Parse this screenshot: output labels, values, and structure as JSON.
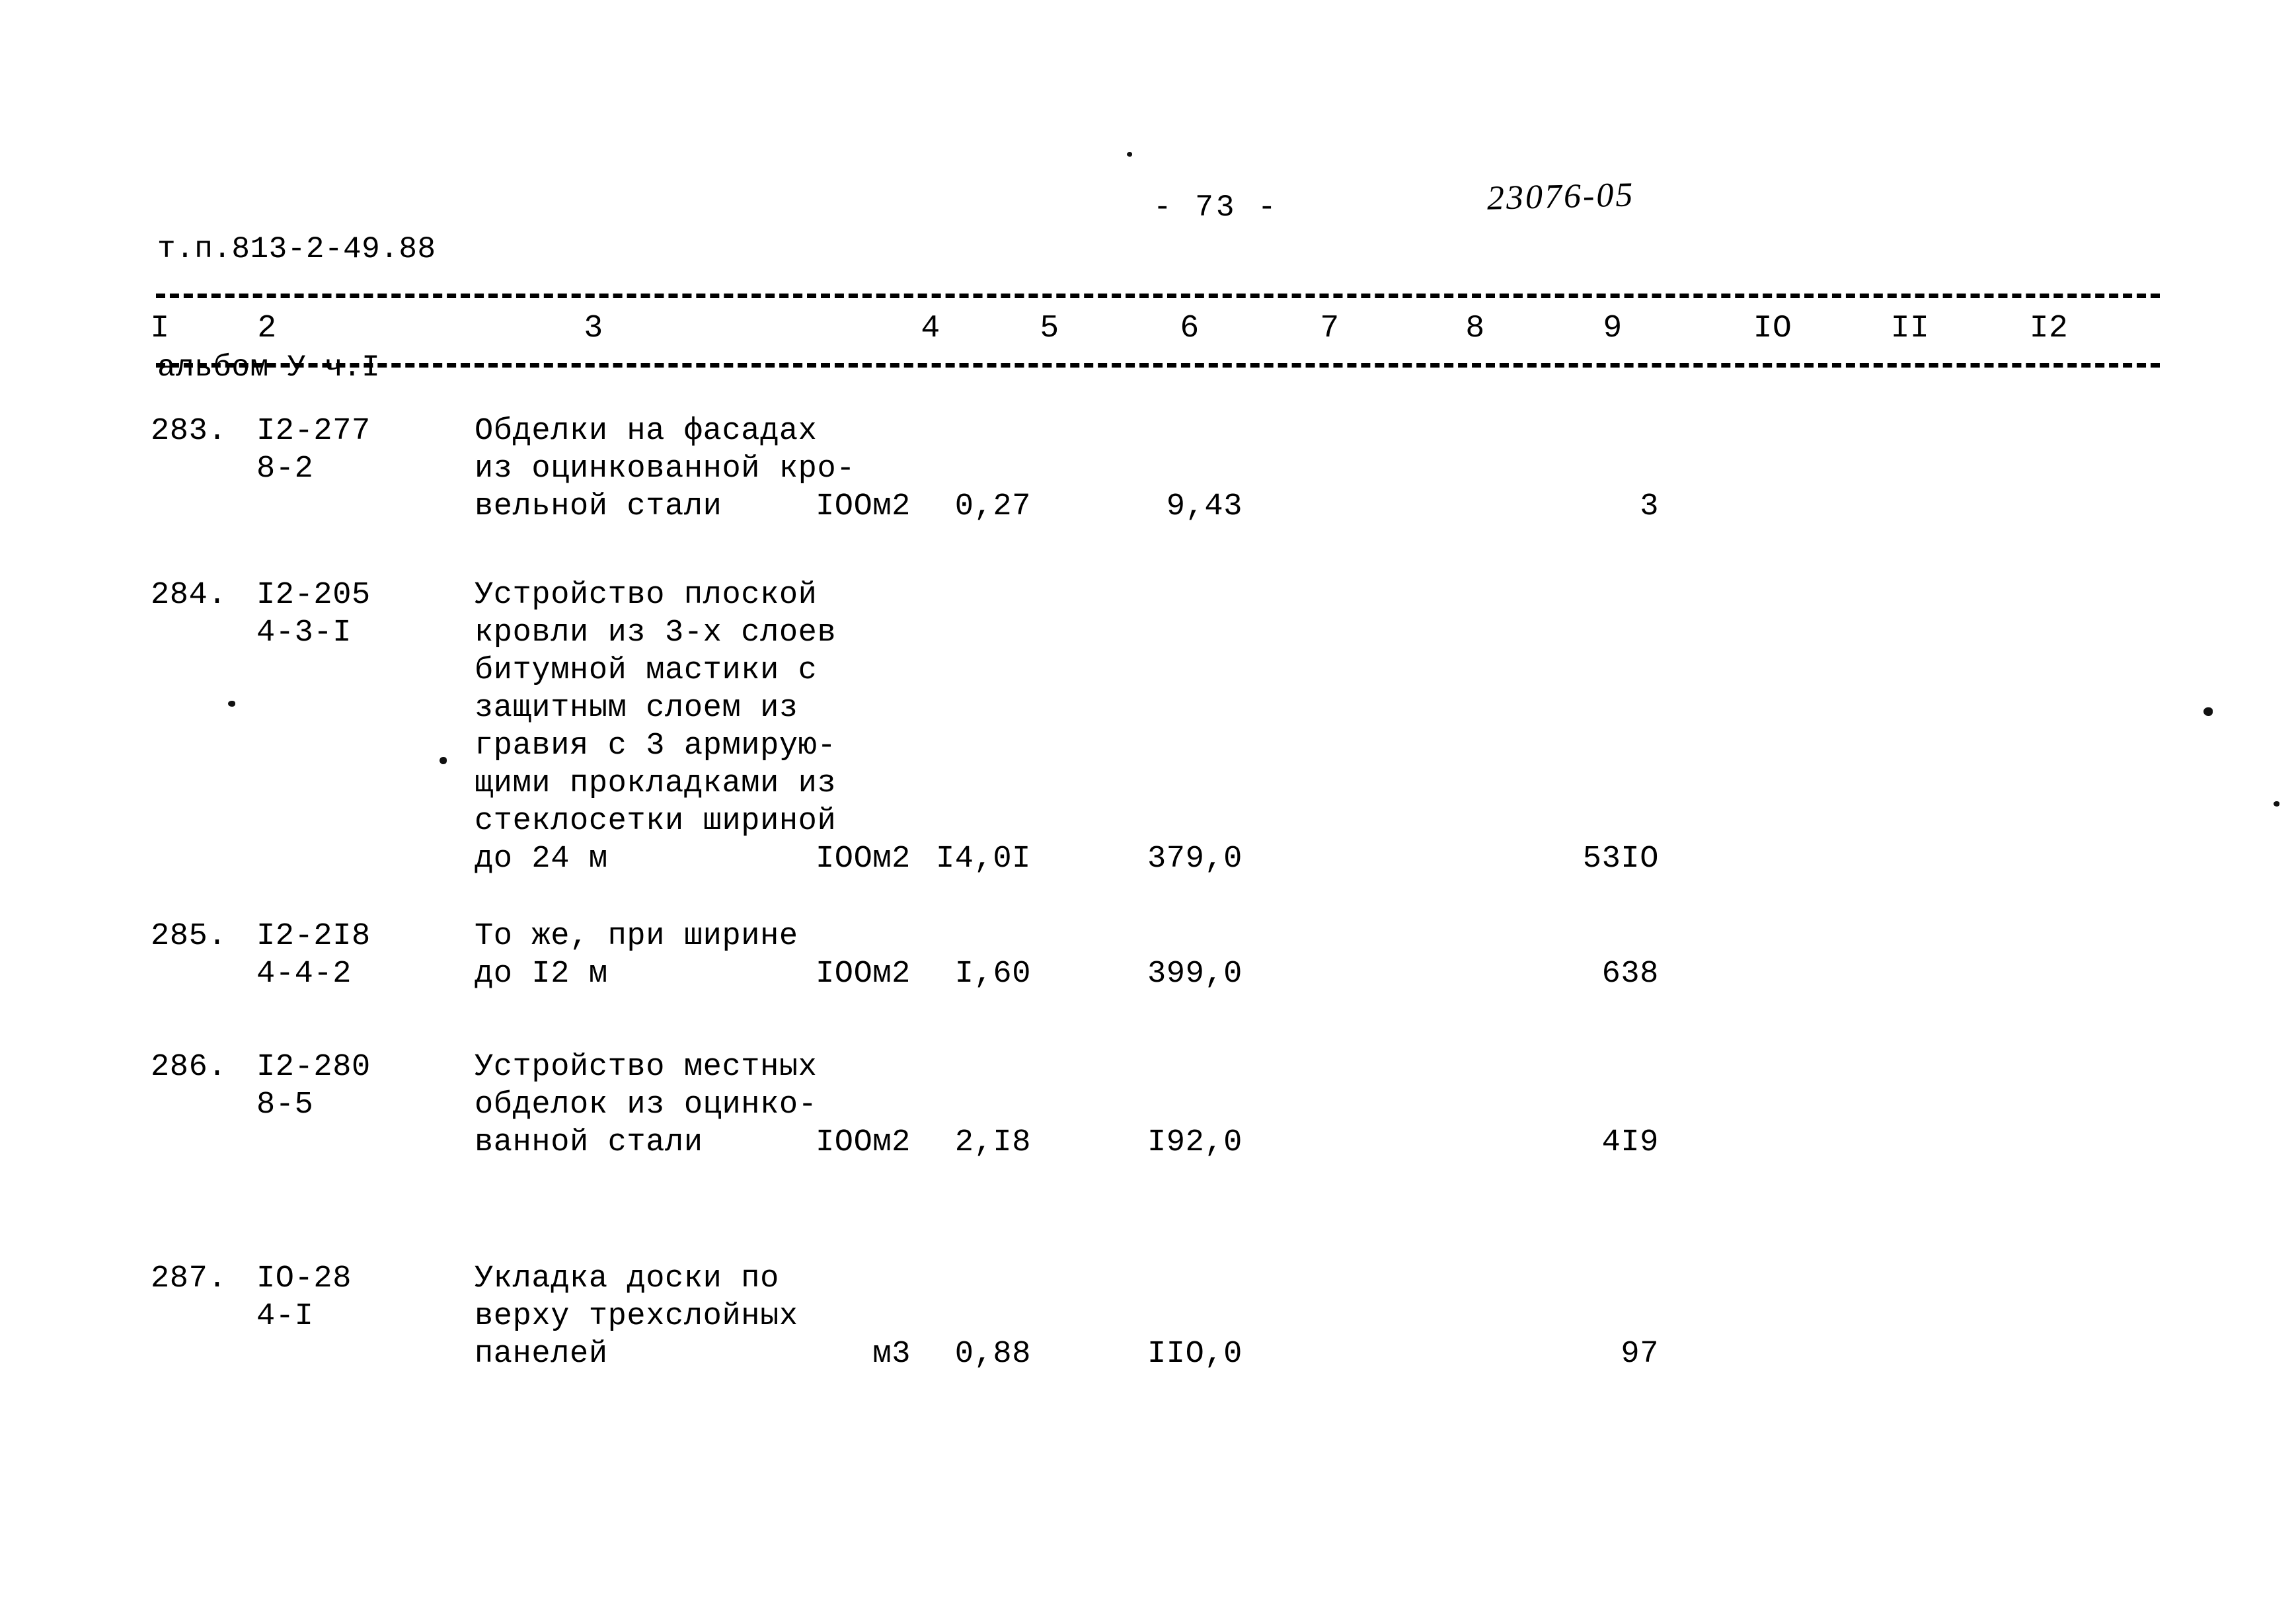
{
  "header": {
    "document_code": "т.п.813-2-49.88",
    "album": "альбом У ч.I",
    "page_number": "- 73 -",
    "archive_code": "23076-05"
  },
  "table": {
    "column_headers": [
      "I",
      "2",
      "3",
      "4",
      "5",
      "6",
      "7",
      "8",
      "9",
      "IO",
      "II",
      "I2"
    ],
    "rows": [
      {
        "number": "283.",
        "code_line1": "I2-277",
        "code_line2": "8-2",
        "description": "Обделки на фасадах\nиз оцинкованной кро-\nвельной стали",
        "unit": "IOOм2",
        "quantity": "0,27",
        "rate": "9,43",
        "sum": "3"
      },
      {
        "number": "284.",
        "code_line1": "I2-205",
        "code_line2": "4-3-I",
        "description": "Устройство плоской\nкровли из 3-х слоев\nбитумной мастики с\nзащитным слоем из\nгравия с 3 армирую-\nщими прокладками из\nстеклосетки шириной\nдо 24 м",
        "unit": "IOOм2",
        "quantity": "I4,0I",
        "rate": "379,0",
        "sum": "53IO"
      },
      {
        "number": "285.",
        "code_line1": "I2-2I8",
        "code_line2": "4-4-2",
        "description": "То же, при ширине\nдо I2 м",
        "unit": "IOOм2",
        "quantity": "I,60",
        "rate": "399,0",
        "sum": "638"
      },
      {
        "number": "286.",
        "code_line1": "I2-280",
        "code_line2": "8-5",
        "description": "Устройство местных\nобделок из оцинко-\nванной стали",
        "unit": "IOOм2",
        "quantity": "2,I8",
        "rate": "I92,0",
        "sum": "4I9"
      },
      {
        "number": "287.",
        "code_line1": "IO-28",
        "code_line2": "4-I",
        "description": "Укладка доски по\nверху трехслойных\nпанелей",
        "unit": "м3",
        "quantity": "0,88",
        "rate": "IIO,0",
        "sum": "97"
      }
    ]
  }
}
